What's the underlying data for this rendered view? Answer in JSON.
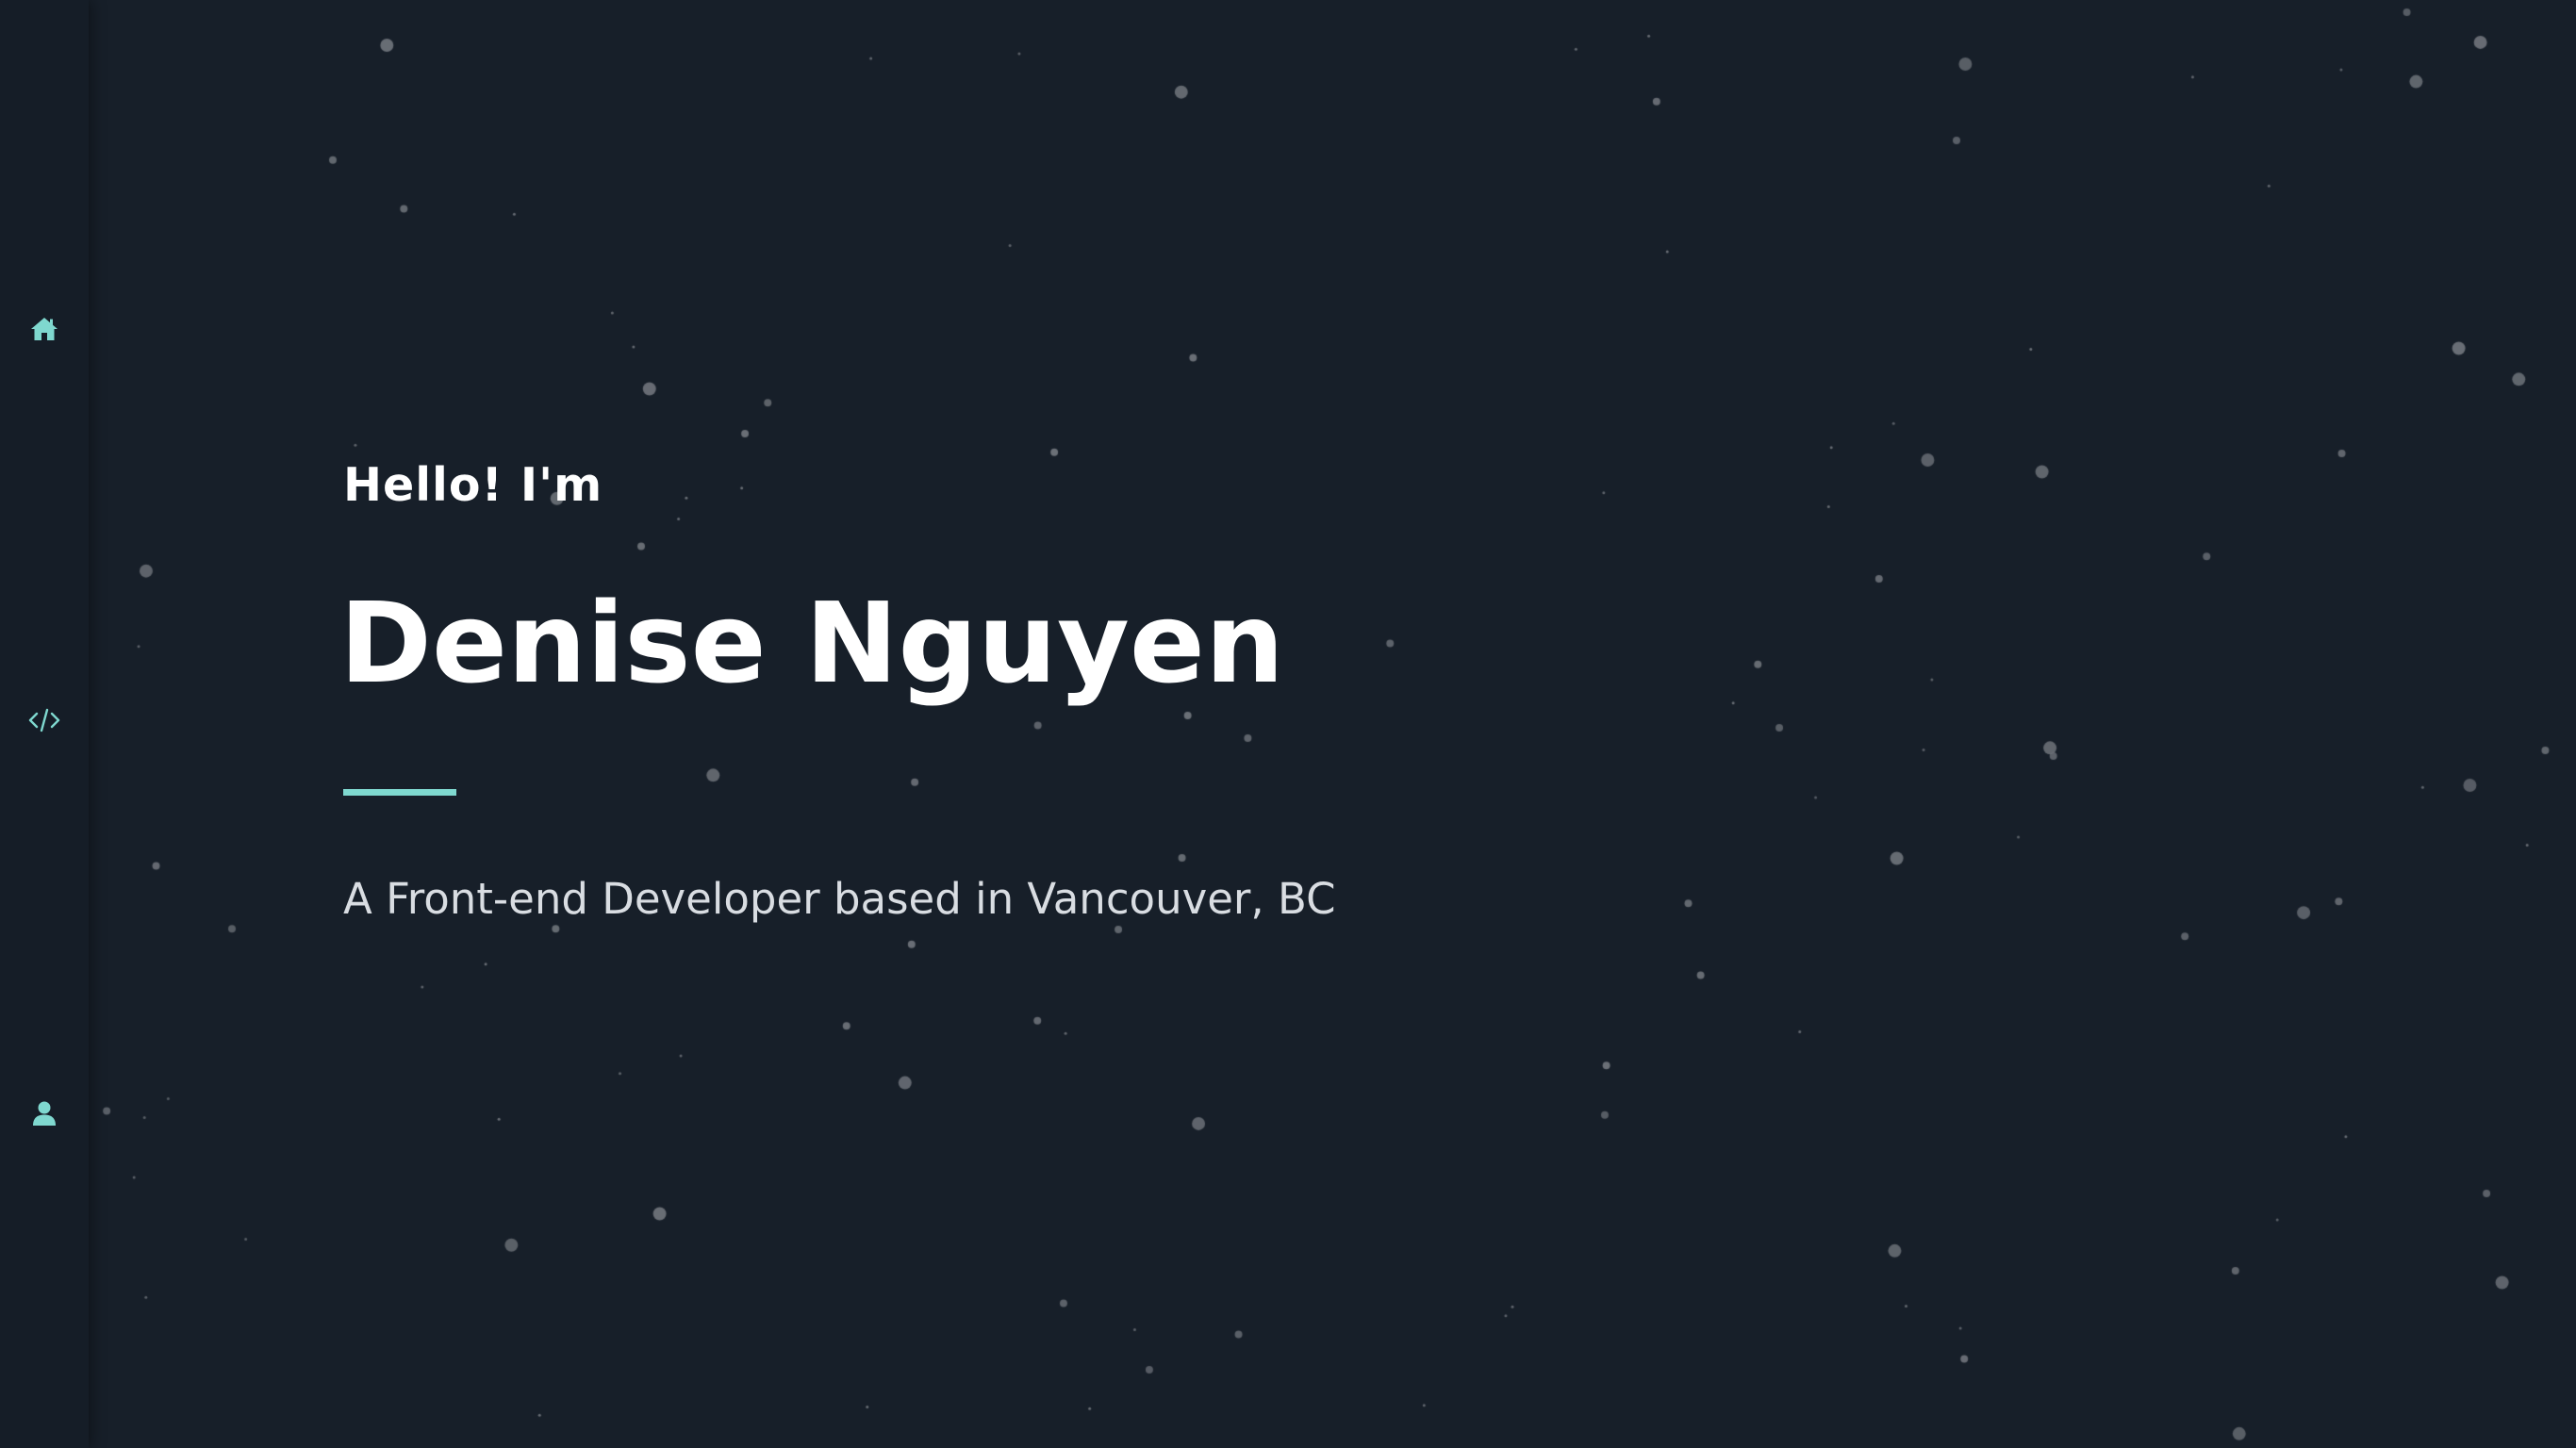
{
  "nav": {
    "items": [
      {
        "icon": "home-icon",
        "label": "Home"
      },
      {
        "icon": "code-icon",
        "label": "Projects"
      },
      {
        "icon": "user-icon",
        "label": "About"
      }
    ]
  },
  "hero": {
    "greeting": "Hello! I'm",
    "name": "Denise Nguyen",
    "tagline": "A Front-end Developer based in Vancouver, BC"
  },
  "colors": {
    "background": "#171f29",
    "sidebar": "#151d27",
    "accent": "#7fd8cf",
    "text": "#ffffff",
    "tagline": "#d9dde2",
    "particles": "#6b7077"
  }
}
